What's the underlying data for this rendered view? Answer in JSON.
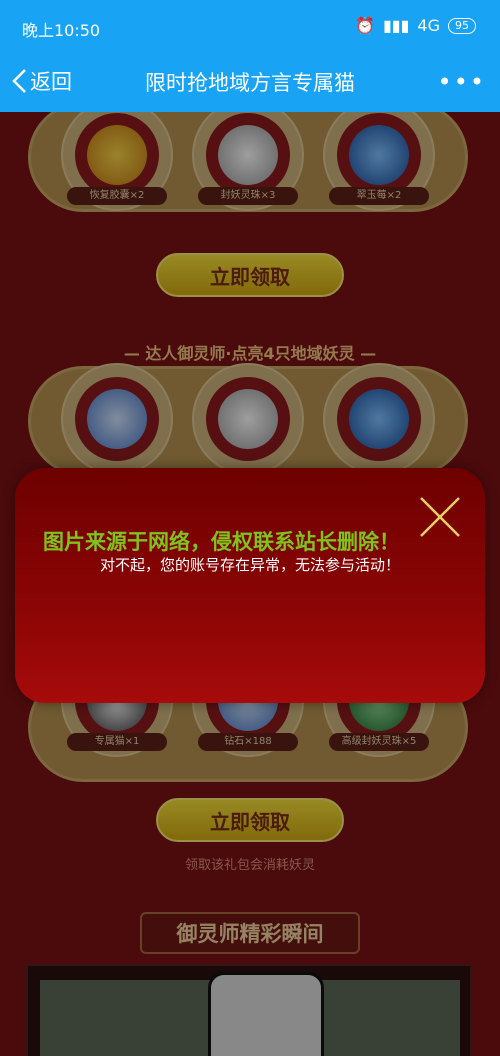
{
  "status_bar": {
    "time": "晚上10:50",
    "network": "4G",
    "battery": "95"
  },
  "nav": {
    "back_label": "返回",
    "title": "限时抢地域方言专属猫",
    "more": "•••"
  },
  "panel1": {
    "items": [
      "恢复胶囊×2",
      "封妖灵珠×3",
      "翠玉莓×2"
    ]
  },
  "claim_label": "立即领取",
  "section2": {
    "title": "— 达人御灵师·点亮4只地域妖灵 —"
  },
  "panel3": {
    "items": [
      "专属猫×1",
      "钻石×188",
      "高级封妖灵珠×5"
    ]
  },
  "note": "领取该礼包会消耗妖灵",
  "banner": "御灵师精彩瞬间",
  "modal": {
    "watermark": "图片来源于网络，侵权联系站长删除！",
    "message": "对不起，您的账号存在异常，无法参与活动！"
  },
  "colors": {
    "nav_bg": "#18a3f4",
    "modal_bg": "#8c0505",
    "button": "#f5de3a",
    "watermark": "#7fc31f"
  }
}
